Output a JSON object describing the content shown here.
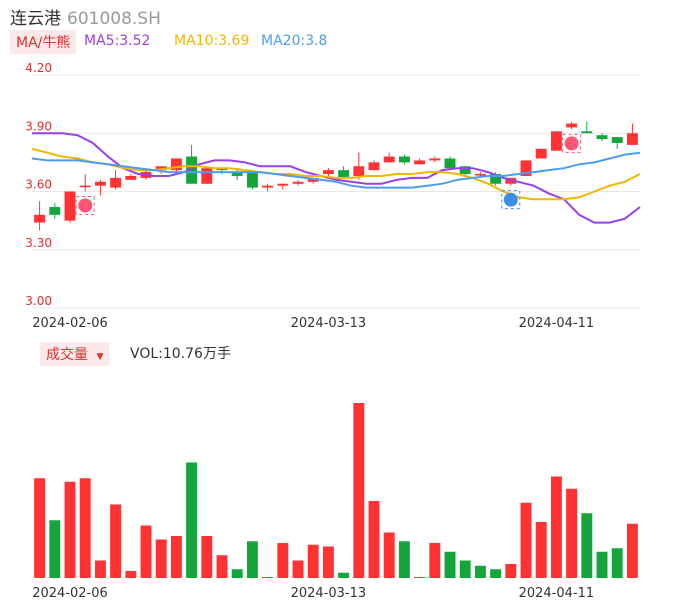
{
  "header": {
    "name": "连云港",
    "code": "601008.SH"
  },
  "legend": {
    "ma_button": "MA/牛熊",
    "ma5": "MA5:3.52",
    "ma10": "MA10:3.69",
    "ma20": "MA20:3.8",
    "vol_button": "成交量",
    "vol_value": "VOL:10.76万手"
  },
  "colors": {
    "up": "#ff3333",
    "down": "#14a53b",
    "ma5": "#9b3fe6",
    "ma10": "#f2b600",
    "ma20": "#4d9ded",
    "grid": "#e8e8e8",
    "axis_label": "#e03030"
  },
  "icons": [
    "bull-icon",
    "bull-icon",
    "bear-icon"
  ],
  "chart_data": {
    "type": "candlestick",
    "ylim": [
      3.0,
      4.2
    ],
    "y_ticks": [
      "4.20",
      "3.90",
      "3.60",
      "3.30",
      "3.00"
    ],
    "x_ticks": [
      {
        "index": 2,
        "label": "2024-02-06"
      },
      {
        "index": 19,
        "label": "2024-03-13"
      },
      {
        "index": 34,
        "label": "2024-04-11"
      }
    ],
    "candles": [
      {
        "o": 3.44,
        "h": 3.55,
        "l": 3.4,
        "c": 3.48
      },
      {
        "o": 3.52,
        "h": 3.54,
        "l": 3.46,
        "c": 3.48
      },
      {
        "o": 3.45,
        "h": 3.6,
        "l": 3.44,
        "c": 3.6
      },
      {
        "o": 3.63,
        "h": 3.69,
        "l": 3.6,
        "c": 3.63
      },
      {
        "o": 3.63,
        "h": 3.66,
        "l": 3.58,
        "c": 3.65
      },
      {
        "o": 3.62,
        "h": 3.71,
        "l": 3.61,
        "c": 3.67
      },
      {
        "o": 3.66,
        "h": 3.69,
        "l": 3.66,
        "c": 3.68
      },
      {
        "o": 3.67,
        "h": 3.71,
        "l": 3.66,
        "c": 3.7
      },
      {
        "o": 3.71,
        "h": 3.72,
        "l": 3.69,
        "c": 3.73
      },
      {
        "o": 3.71,
        "h": 3.77,
        "l": 3.7,
        "c": 3.77
      },
      {
        "o": 3.78,
        "h": 3.84,
        "l": 3.64,
        "c": 3.64
      },
      {
        "o": 3.64,
        "h": 3.72,
        "l": 3.64,
        "c": 3.72
      },
      {
        "o": 3.72,
        "h": 3.72,
        "l": 3.69,
        "c": 3.71
      },
      {
        "o": 3.7,
        "h": 3.72,
        "l": 3.66,
        "c": 3.68
      },
      {
        "o": 3.7,
        "h": 3.7,
        "l": 3.61,
        "c": 3.62
      },
      {
        "o": 3.62,
        "h": 3.64,
        "l": 3.6,
        "c": 3.63
      },
      {
        "o": 3.63,
        "h": 3.64,
        "l": 3.61,
        "c": 3.64
      },
      {
        "o": 3.64,
        "h": 3.66,
        "l": 3.63,
        "c": 3.65
      },
      {
        "o": 3.65,
        "h": 3.67,
        "l": 3.64,
        "c": 3.67
      },
      {
        "o": 3.69,
        "h": 3.72,
        "l": 3.68,
        "c": 3.71
      },
      {
        "o": 3.71,
        "h": 3.73,
        "l": 3.67,
        "c": 3.67
      },
      {
        "o": 3.68,
        "h": 3.8,
        "l": 3.66,
        "c": 3.73
      },
      {
        "o": 3.71,
        "h": 3.76,
        "l": 3.71,
        "c": 3.75
      },
      {
        "o": 3.75,
        "h": 3.8,
        "l": 3.75,
        "c": 3.78
      },
      {
        "o": 3.78,
        "h": 3.79,
        "l": 3.74,
        "c": 3.75
      },
      {
        "o": 3.74,
        "h": 3.77,
        "l": 3.74,
        "c": 3.76
      },
      {
        "o": 3.76,
        "h": 3.78,
        "l": 3.75,
        "c": 3.77
      },
      {
        "o": 3.77,
        "h": 3.78,
        "l": 3.71,
        "c": 3.72
      },
      {
        "o": 3.73,
        "h": 3.73,
        "l": 3.68,
        "c": 3.69
      },
      {
        "o": 3.69,
        "h": 3.7,
        "l": 3.67,
        "c": 3.69
      },
      {
        "o": 3.69,
        "h": 3.7,
        "l": 3.63,
        "c": 3.64
      },
      {
        "o": 3.64,
        "h": 3.67,
        "l": 3.63,
        "c": 3.67
      },
      {
        "o": 3.68,
        "h": 3.76,
        "l": 3.68,
        "c": 3.76
      },
      {
        "o": 3.77,
        "h": 3.82,
        "l": 3.77,
        "c": 3.82
      },
      {
        "o": 3.81,
        "h": 3.91,
        "l": 3.81,
        "c": 3.91
      },
      {
        "o": 3.93,
        "h": 3.96,
        "l": 3.92,
        "c": 3.95
      },
      {
        "o": 3.91,
        "h": 3.96,
        "l": 3.9,
        "c": 3.9
      },
      {
        "o": 3.89,
        "h": 3.9,
        "l": 3.86,
        "c": 3.87
      },
      {
        "o": 3.88,
        "h": 3.88,
        "l": 3.82,
        "c": 3.85
      },
      {
        "o": 3.84,
        "h": 3.95,
        "l": 3.84,
        "c": 3.9
      }
    ],
    "ma5": [
      3.9,
      3.9,
      3.9,
      3.89,
      3.85,
      3.78,
      3.72,
      3.69,
      3.68,
      3.68,
      3.7,
      3.74,
      3.76,
      3.76,
      3.75,
      3.73,
      3.73,
      3.73,
      3.7,
      3.68,
      3.66,
      3.65,
      3.64,
      3.64,
      3.66,
      3.67,
      3.67,
      3.71,
      3.72,
      3.72,
      3.7,
      3.67,
      3.65,
      3.63,
      3.59,
      3.56,
      3.48,
      3.44,
      3.44,
      3.46,
      3.52
    ],
    "ma10": [
      3.82,
      3.8,
      3.78,
      3.77,
      3.75,
      3.74,
      3.72,
      3.71,
      3.71,
      3.72,
      3.73,
      3.73,
      3.72,
      3.72,
      3.71,
      3.7,
      3.69,
      3.69,
      3.68,
      3.68,
      3.67,
      3.67,
      3.68,
      3.68,
      3.69,
      3.69,
      3.7,
      3.7,
      3.69,
      3.67,
      3.64,
      3.6,
      3.57,
      3.56,
      3.56,
      3.56,
      3.57,
      3.6,
      3.63,
      3.65,
      3.69
    ],
    "ma20": [
      3.77,
      3.76,
      3.76,
      3.76,
      3.75,
      3.74,
      3.73,
      3.72,
      3.71,
      3.7,
      3.7,
      3.7,
      3.7,
      3.7,
      3.7,
      3.7,
      3.69,
      3.68,
      3.67,
      3.66,
      3.65,
      3.63,
      3.62,
      3.62,
      3.62,
      3.62,
      3.63,
      3.64,
      3.66,
      3.67,
      3.68,
      3.68,
      3.69,
      3.7,
      3.71,
      3.72,
      3.74,
      3.75,
      3.77,
      3.79,
      3.8
    ],
    "volume": [
      {
        "v": 0.57,
        "up": true
      },
      {
        "v": 0.33,
        "up": false
      },
      {
        "v": 0.55,
        "up": true
      },
      {
        "v": 0.57,
        "up": true
      },
      {
        "v": 0.1,
        "up": true
      },
      {
        "v": 0.42,
        "up": true
      },
      {
        "v": 0.04,
        "up": true
      },
      {
        "v": 0.3,
        "up": true
      },
      {
        "v": 0.22,
        "up": true
      },
      {
        "v": 0.24,
        "up": true
      },
      {
        "v": 0.66,
        "up": false
      },
      {
        "v": 0.24,
        "up": true
      },
      {
        "v": 0.13,
        "up": true
      },
      {
        "v": 0.05,
        "up": false
      },
      {
        "v": 0.21,
        "up": false
      },
      {
        "v": 0.005,
        "up": true
      },
      {
        "v": 0.2,
        "up": true
      },
      {
        "v": 0.1,
        "up": true
      },
      {
        "v": 0.19,
        "up": true
      },
      {
        "v": 0.18,
        "up": true
      },
      {
        "v": 0.03,
        "up": false
      },
      {
        "v": 1.0,
        "up": true
      },
      {
        "v": 0.44,
        "up": true
      },
      {
        "v": 0.26,
        "up": true
      },
      {
        "v": 0.21,
        "up": false
      },
      {
        "v": 0.005,
        "up": true
      },
      {
        "v": 0.2,
        "up": true
      },
      {
        "v": 0.15,
        "up": false
      },
      {
        "v": 0.1,
        "up": false
      },
      {
        "v": 0.07,
        "up": false
      },
      {
        "v": 0.05,
        "up": false
      },
      {
        "v": 0.08,
        "up": true
      },
      {
        "v": 0.43,
        "up": true
      },
      {
        "v": 0.32,
        "up": true
      },
      {
        "v": 0.58,
        "up": true
      },
      {
        "v": 0.51,
        "up": true
      },
      {
        "v": 0.37,
        "up": false
      },
      {
        "v": 0.15,
        "up": false
      },
      {
        "v": 0.17,
        "up": false
      },
      {
        "v": 0.31,
        "up": true
      }
    ],
    "markers": [
      {
        "index": 3,
        "icon": "bull-icon"
      },
      {
        "index": 31,
        "icon": "bear-icon"
      },
      {
        "index": 35,
        "icon": "bull-icon"
      }
    ]
  }
}
